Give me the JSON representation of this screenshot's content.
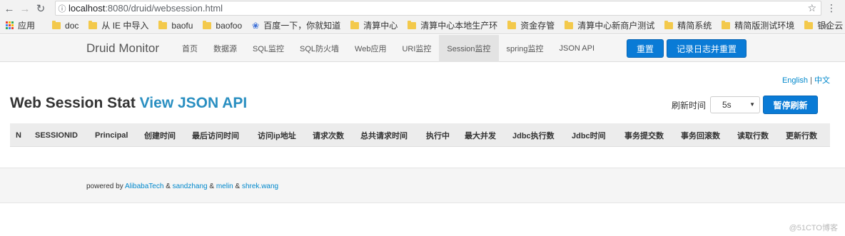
{
  "browser": {
    "url_host": "localhost",
    "url_path": ":8080/druid/websession.html",
    "bookmarks": [
      {
        "label": "应用",
        "icon": "apps-grid-icon"
      },
      {
        "label": "doc",
        "icon": "folder-icon"
      },
      {
        "label": "从 IE 中导入",
        "icon": "folder-icon"
      },
      {
        "label": "baofu",
        "icon": "folder-icon"
      },
      {
        "label": "baofoo",
        "icon": "folder-icon"
      },
      {
        "label": "百度一下，你就知道",
        "icon": "baidu-paw-icon"
      },
      {
        "label": "清算中心",
        "icon": "folder-icon"
      },
      {
        "label": "清算中心本地生产环",
        "icon": "folder-icon"
      },
      {
        "label": "资金存管",
        "icon": "folder-icon"
      },
      {
        "label": "清算中心新商户测试",
        "icon": "folder-icon"
      },
      {
        "label": "精简系统",
        "icon": "folder-icon"
      },
      {
        "label": "精简版测试环境",
        "icon": "folder-icon"
      },
      {
        "label": "银企云",
        "icon": "folder-icon"
      }
    ],
    "more": "»"
  },
  "druid": {
    "brand": "Druid Monitor",
    "nav": [
      "首页",
      "数据源",
      "SQL监控",
      "SQL防火墙",
      "Web应用",
      "URI监控",
      "Session监控",
      "spring监控",
      "JSON API"
    ],
    "active_nav_index": 6,
    "reset_label": "重置",
    "log_reset_label": "记录日志并重置",
    "colors": {
      "button_blue": "#0a7bd6",
      "link": "#0088cc"
    }
  },
  "page": {
    "lang_en": "English",
    "lang_sep": "|",
    "lang_zh": "中文",
    "title": "Web Session Stat",
    "title_link": "View JSON API",
    "refresh_label": "刷新时间",
    "refresh_value": "5s",
    "pause_label": "暂停刷新",
    "columns": [
      "N",
      "SESSIONID",
      "Principal",
      "创建时间",
      "最后访问时间",
      "访问ip地址",
      "请求次数",
      "总共请求时间",
      "执行中",
      "最大并发",
      "Jdbc执行数",
      "Jdbc时间",
      "事务提交数",
      "事务回滚数",
      "读取行数",
      "更新行数"
    ],
    "rows": []
  },
  "footer": {
    "prefix": "powered by",
    "authors": [
      "AlibabaTech",
      "sandzhang",
      "melin",
      "shrek.wang"
    ],
    "sep": "&"
  },
  "watermark": "@51CTO博客"
}
